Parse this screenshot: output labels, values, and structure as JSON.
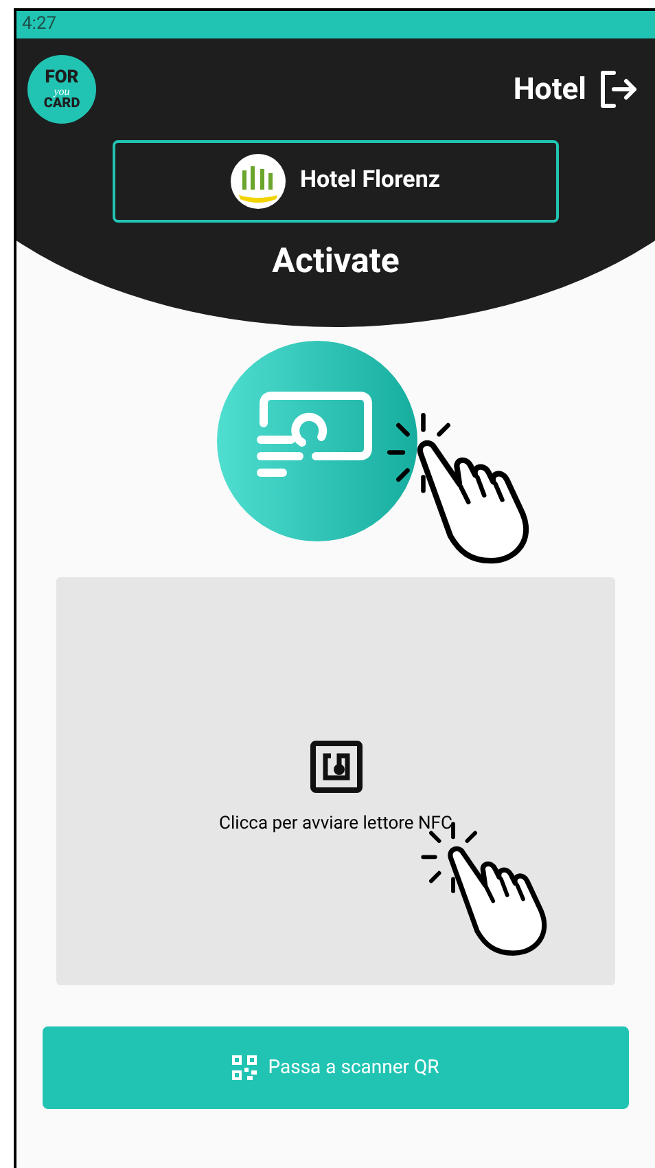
{
  "status_bar": {
    "time": "4:27"
  },
  "header": {
    "logo": {
      "top": "FOR",
      "middle": "you",
      "bottom": "CARD"
    },
    "user_label": "Hotel",
    "hotel_selector": {
      "name": "Hotel Florenz"
    },
    "title": "Activate"
  },
  "nfc_panel": {
    "label": "Clicca per avviare lettore NFC"
  },
  "qr_button": {
    "label": "Passa a scanner QR"
  }
}
